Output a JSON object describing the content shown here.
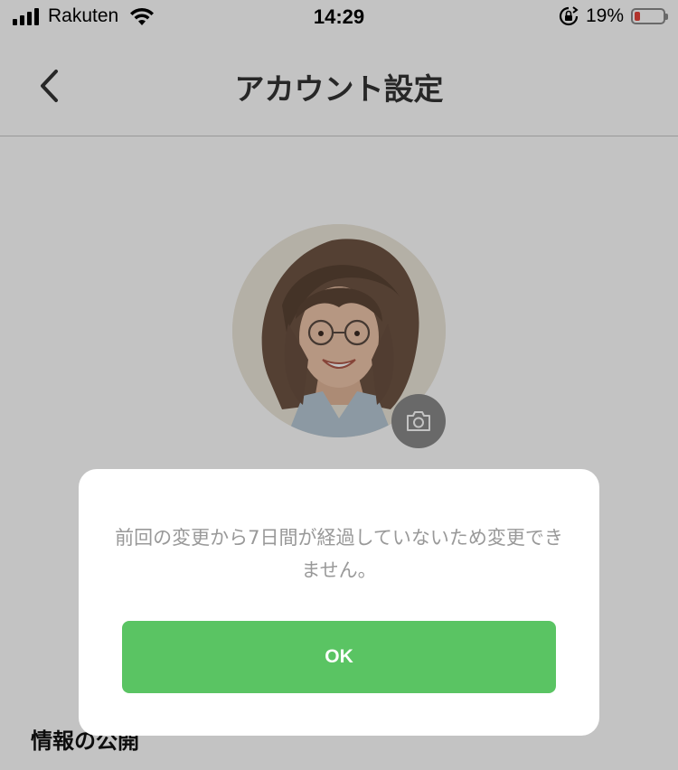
{
  "status_bar": {
    "carrier": "Rakuten",
    "time": "14:29",
    "battery_percent": "19%",
    "battery_level": 0.19,
    "battery_color": "#e8443a"
  },
  "nav": {
    "back_icon": "chevron-left-icon",
    "title": "アカウント設定"
  },
  "profile": {
    "camera_icon": "camera-icon"
  },
  "section": {
    "heading": "情報の公開"
  },
  "dialog": {
    "message": "前回の変更から7日間が経過していないため変更できません。",
    "ok_label": "OK",
    "ok_color": "#5ac463"
  }
}
